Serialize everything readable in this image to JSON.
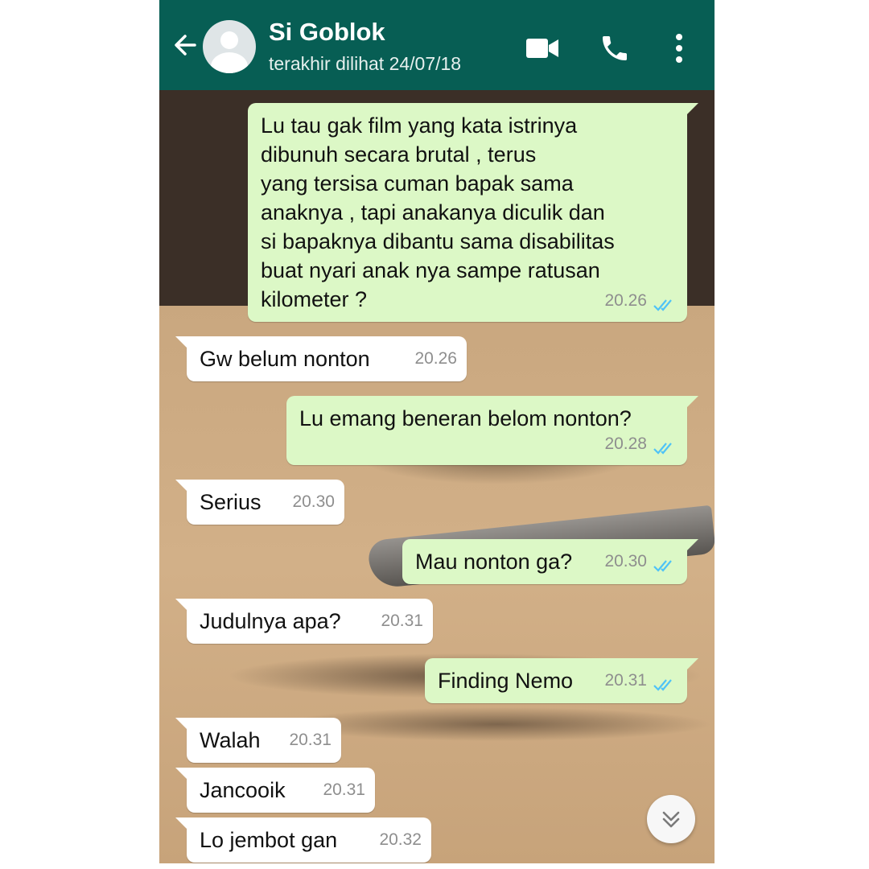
{
  "header": {
    "back_icon": "arrow-left-icon",
    "contact_name": "Si Goblok",
    "last_seen": "terakhir dilihat 24/07/18",
    "actions": [
      "video-call-icon",
      "phone-call-icon",
      "more-vert-icon"
    ],
    "color": "#075e54"
  },
  "messages": [
    {
      "dir": "out",
      "text": "Lu tau gak film yang kata istrinya\ndibunuh secara brutal , terus\nyang tersisa cuman bapak sama\nanaknya , tapi anakanya diculik dan\nsi bapaknya dibantu sama disabilitas\nbuat nyari anak nya sampe ratusan\nkilometer ?",
      "time": "20.26",
      "read": true
    },
    {
      "dir": "in",
      "text": "Gw belum nonton",
      "time": "20.26"
    },
    {
      "dir": "out",
      "text": "Lu emang beneran belom nonton?",
      "time": "20.28",
      "read": true
    },
    {
      "dir": "in",
      "text": "Serius",
      "time": "20.30"
    },
    {
      "dir": "out",
      "text": "Mau nonton ga?",
      "time": "20.30",
      "read": true
    },
    {
      "dir": "in",
      "text": "Judulnya apa?",
      "time": "20.31"
    },
    {
      "dir": "out",
      "text": "Finding Nemo",
      "time": "20.31",
      "read": true
    },
    {
      "dir": "in",
      "text": "Walah",
      "time": "20.31"
    },
    {
      "dir": "in",
      "text": "Jancooik",
      "time": "20.31"
    },
    {
      "dir": "in",
      "text": "Lo jembot gan",
      "time": "20.32"
    }
  ],
  "colors": {
    "outgoing_bubble": "#dcf8c6",
    "incoming_bubble": "#ffffff",
    "read_ticks": "#4fc3f7"
  },
  "scroll_button_icon": "double-chevron-down-icon"
}
